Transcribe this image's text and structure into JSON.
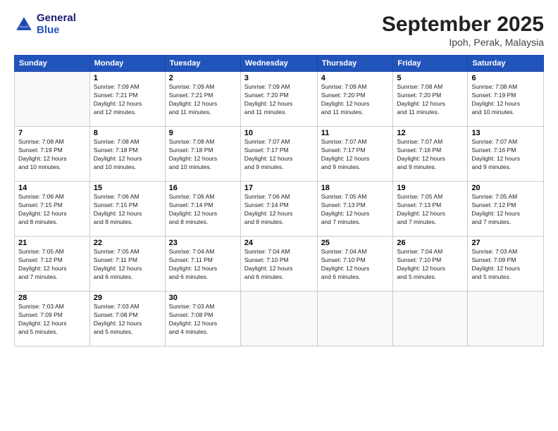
{
  "logo": {
    "line1": "General",
    "line2": "Blue"
  },
  "title": "September 2025",
  "location": "Ipoh, Perak, Malaysia",
  "weekdays": [
    "Sunday",
    "Monday",
    "Tuesday",
    "Wednesday",
    "Thursday",
    "Friday",
    "Saturday"
  ],
  "weeks": [
    [
      {
        "day": "",
        "info": ""
      },
      {
        "day": "1",
        "info": "Sunrise: 7:09 AM\nSunset: 7:21 PM\nDaylight: 12 hours\nand 12 minutes."
      },
      {
        "day": "2",
        "info": "Sunrise: 7:09 AM\nSunset: 7:21 PM\nDaylight: 12 hours\nand 11 minutes."
      },
      {
        "day": "3",
        "info": "Sunrise: 7:09 AM\nSunset: 7:20 PM\nDaylight: 12 hours\nand 11 minutes."
      },
      {
        "day": "4",
        "info": "Sunrise: 7:09 AM\nSunset: 7:20 PM\nDaylight: 12 hours\nand 11 minutes."
      },
      {
        "day": "5",
        "info": "Sunrise: 7:08 AM\nSunset: 7:20 PM\nDaylight: 12 hours\nand 11 minutes."
      },
      {
        "day": "6",
        "info": "Sunrise: 7:08 AM\nSunset: 7:19 PM\nDaylight: 12 hours\nand 10 minutes."
      }
    ],
    [
      {
        "day": "7",
        "info": "Sunrise: 7:08 AM\nSunset: 7:19 PM\nDaylight: 12 hours\nand 10 minutes."
      },
      {
        "day": "8",
        "info": "Sunrise: 7:08 AM\nSunset: 7:18 PM\nDaylight: 12 hours\nand 10 minutes."
      },
      {
        "day": "9",
        "info": "Sunrise: 7:08 AM\nSunset: 7:18 PM\nDaylight: 12 hours\nand 10 minutes."
      },
      {
        "day": "10",
        "info": "Sunrise: 7:07 AM\nSunset: 7:17 PM\nDaylight: 12 hours\nand 9 minutes."
      },
      {
        "day": "11",
        "info": "Sunrise: 7:07 AM\nSunset: 7:17 PM\nDaylight: 12 hours\nand 9 minutes."
      },
      {
        "day": "12",
        "info": "Sunrise: 7:07 AM\nSunset: 7:16 PM\nDaylight: 12 hours\nand 9 minutes."
      },
      {
        "day": "13",
        "info": "Sunrise: 7:07 AM\nSunset: 7:16 PM\nDaylight: 12 hours\nand 9 minutes."
      }
    ],
    [
      {
        "day": "14",
        "info": "Sunrise: 7:06 AM\nSunset: 7:15 PM\nDaylight: 12 hours\nand 8 minutes."
      },
      {
        "day": "15",
        "info": "Sunrise: 7:06 AM\nSunset: 7:15 PM\nDaylight: 12 hours\nand 8 minutes."
      },
      {
        "day": "16",
        "info": "Sunrise: 7:06 AM\nSunset: 7:14 PM\nDaylight: 12 hours\nand 8 minutes."
      },
      {
        "day": "17",
        "info": "Sunrise: 7:06 AM\nSunset: 7:14 PM\nDaylight: 12 hours\nand 8 minutes."
      },
      {
        "day": "18",
        "info": "Sunrise: 7:05 AM\nSunset: 7:13 PM\nDaylight: 12 hours\nand 7 minutes."
      },
      {
        "day": "19",
        "info": "Sunrise: 7:05 AM\nSunset: 7:13 PM\nDaylight: 12 hours\nand 7 minutes."
      },
      {
        "day": "20",
        "info": "Sunrise: 7:05 AM\nSunset: 7:12 PM\nDaylight: 12 hours\nand 7 minutes."
      }
    ],
    [
      {
        "day": "21",
        "info": "Sunrise: 7:05 AM\nSunset: 7:12 PM\nDaylight: 12 hours\nand 7 minutes."
      },
      {
        "day": "22",
        "info": "Sunrise: 7:05 AM\nSunset: 7:11 PM\nDaylight: 12 hours\nand 6 minutes."
      },
      {
        "day": "23",
        "info": "Sunrise: 7:04 AM\nSunset: 7:11 PM\nDaylight: 12 hours\nand 6 minutes."
      },
      {
        "day": "24",
        "info": "Sunrise: 7:04 AM\nSunset: 7:10 PM\nDaylight: 12 hours\nand 6 minutes."
      },
      {
        "day": "25",
        "info": "Sunrise: 7:04 AM\nSunset: 7:10 PM\nDaylight: 12 hours\nand 6 minutes."
      },
      {
        "day": "26",
        "info": "Sunrise: 7:04 AM\nSunset: 7:10 PM\nDaylight: 12 hours\nand 5 minutes."
      },
      {
        "day": "27",
        "info": "Sunrise: 7:03 AM\nSunset: 7:09 PM\nDaylight: 12 hours\nand 5 minutes."
      }
    ],
    [
      {
        "day": "28",
        "info": "Sunrise: 7:03 AM\nSunset: 7:09 PM\nDaylight: 12 hours\nand 5 minutes."
      },
      {
        "day": "29",
        "info": "Sunrise: 7:03 AM\nSunset: 7:08 PM\nDaylight: 12 hours\nand 5 minutes."
      },
      {
        "day": "30",
        "info": "Sunrise: 7:03 AM\nSunset: 7:08 PM\nDaylight: 12 hours\nand 4 minutes."
      },
      {
        "day": "",
        "info": ""
      },
      {
        "day": "",
        "info": ""
      },
      {
        "day": "",
        "info": ""
      },
      {
        "day": "",
        "info": ""
      }
    ]
  ]
}
